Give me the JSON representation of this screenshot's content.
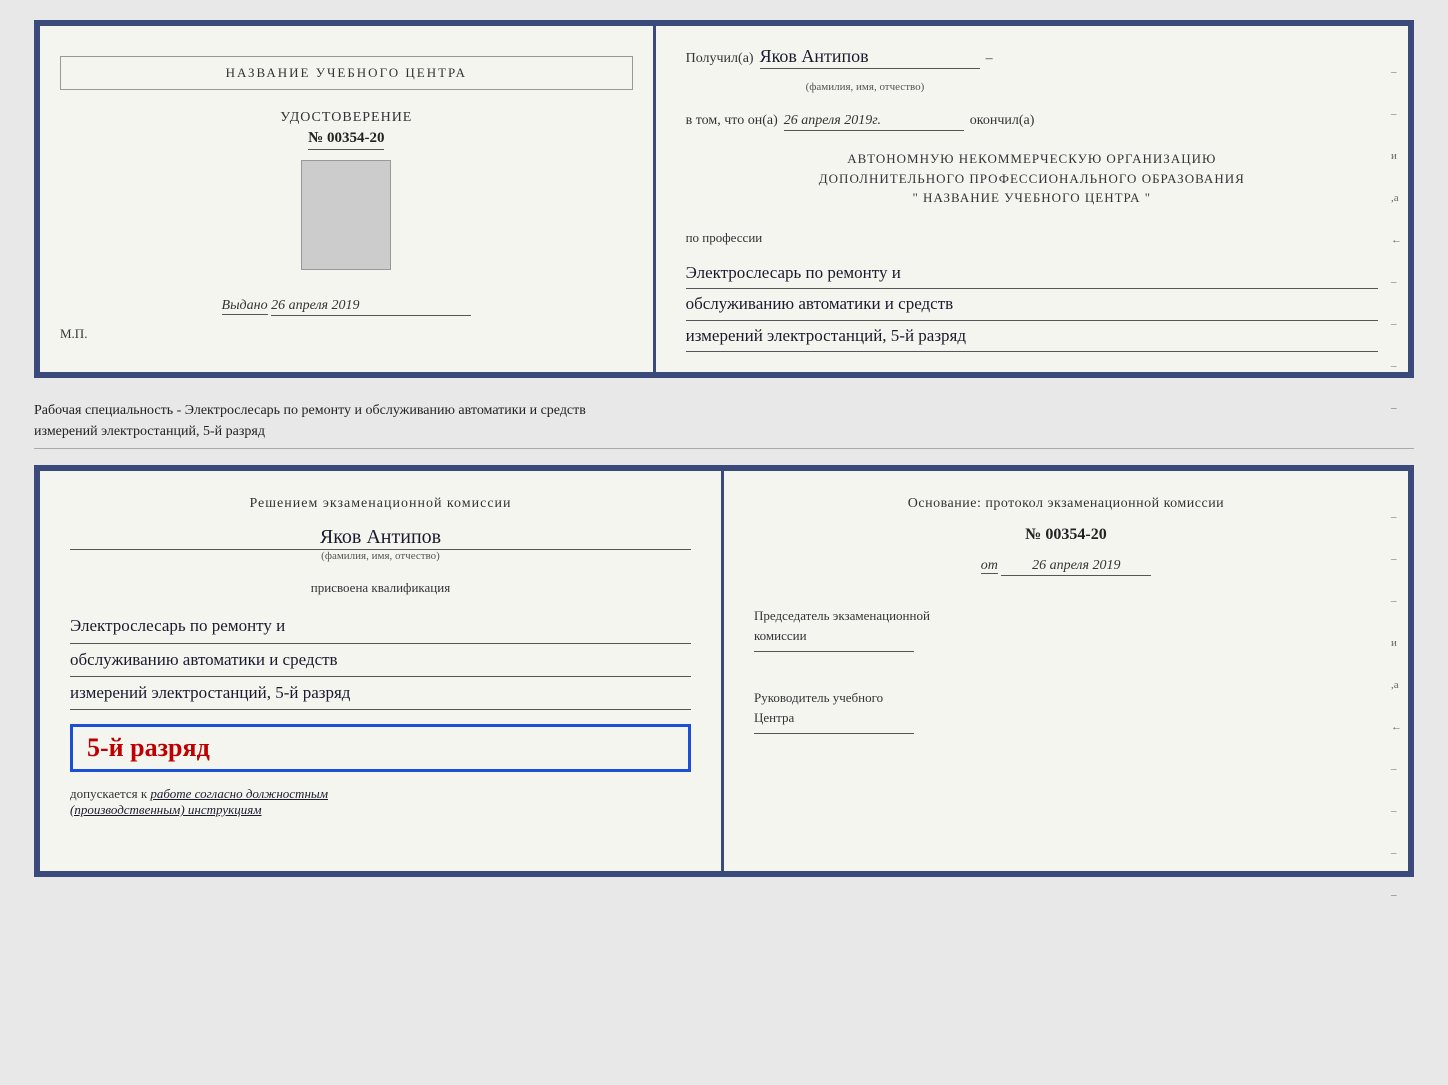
{
  "top_cert": {
    "left": {
      "title": "НАЗВАНИЕ УЧЕБНОГО ЦЕНТРА",
      "udost_label": "УДОСТОВЕРЕНИЕ",
      "udost_number": "№ 00354-20",
      "issued_label": "Выдано",
      "issued_date": "26 апреля 2019",
      "mp_label": "М.П."
    },
    "right": {
      "poluchil_label": "Получил(а)",
      "recipient_name": "Яков Антипов",
      "fio_label": "(фамилия, имя, отчество)",
      "vtom_label": "в том, что он(а)",
      "date_handwritten": "26 апреля 2019г.",
      "okonchil_label": "окончил(а)",
      "org_line1": "АВТОНОМНУЮ НЕКОММЕРЧЕСКУЮ ОРГАНИЗАЦИЮ",
      "org_line2": "ДОПОЛНИТЕЛЬНОГО ПРОФЕССИОНАЛЬНОГО ОБРАЗОВАНИЯ",
      "org_line3": "\"  НАЗВАНИЕ УЧЕБНОГО ЦЕНТРА  \"",
      "po_professii": "по профессии",
      "profession_line1": "Электрослесарь по ремонту и",
      "profession_line2": "обслуживанию автоматики и средств",
      "profession_line3": "измерений электростанций, 5-й разряд"
    }
  },
  "between_text": "Рабочая специальность - Электрослесарь по ремонту и обслуживанию автоматики и средств\nизмерений электростанций, 5-й разряд",
  "bottom_cert": {
    "left": {
      "resheniem_label": "Решением экзаменационной комиссии",
      "name_handwritten": "Яков Антипов",
      "fio_label": "(фамилия, имя, отчество)",
      "prisvoena_label": "присвоена квалификация",
      "qual_line1": "Электрослесарь по ремонту и",
      "qual_line2": "обслуживанию автоматики и средств",
      "qual_line3": "измерений электростанций, 5-й разряд",
      "razryad_display": "5-й разряд",
      "dopusk_prefix": "допускается к",
      "dopusk_handwritten": "работе согласно должностным",
      "dopusk_handwritten2": "(производственным) инструкциям"
    },
    "right": {
      "osnovanie_label": "Основание: протокол экзаменационной комиссии",
      "protocol_number": "№ 00354-20",
      "ot_label": "от",
      "ot_date": "26 апреля 2019",
      "predsedatel_label": "Председатель экзаменационной\nкомиссии",
      "rukovoditel_label": "Руководитель учебного\nЦентра"
    }
  }
}
